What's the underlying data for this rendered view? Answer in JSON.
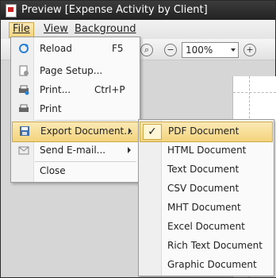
{
  "window": {
    "title": "Preview [Expense Activity by Client]"
  },
  "menubar": {
    "items": [
      {
        "label": "File"
      },
      {
        "label": "View"
      },
      {
        "label": "Background"
      }
    ]
  },
  "toolbar": {
    "zoom_value": "100%"
  },
  "file_menu": {
    "items": [
      {
        "label": "Reload",
        "shortcut": "F5",
        "icon": "reload-icon"
      },
      {
        "label": "Page Setup...",
        "shortcut": "",
        "icon": "page-setup-icon"
      },
      {
        "label": "Print...",
        "shortcut": "Ctrl+P",
        "icon": "print-dialog-icon"
      },
      {
        "label": "Print",
        "shortcut": "",
        "icon": "print-icon"
      },
      {
        "label": "Export Document...",
        "shortcut": "",
        "icon": "save-icon",
        "submenu": true
      },
      {
        "label": "Send E-mail...",
        "shortcut": "",
        "icon": "email-icon",
        "submenu": true
      },
      {
        "label": "Close",
        "shortcut": "",
        "icon": ""
      }
    ]
  },
  "export_submenu": {
    "items": [
      {
        "label": "PDF Document",
        "checked": true
      },
      {
        "label": "HTML Document"
      },
      {
        "label": "Text Document"
      },
      {
        "label": "CSV Document"
      },
      {
        "label": "MHT Document"
      },
      {
        "label": "Excel Document"
      },
      {
        "label": "Rich Text Document"
      },
      {
        "label": "Graphic Document"
      }
    ],
    "check_mark": "✓"
  }
}
